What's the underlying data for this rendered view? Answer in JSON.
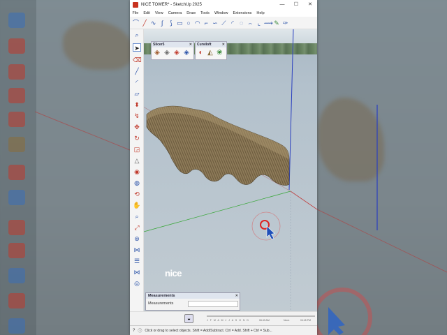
{
  "window": {
    "title": "NICE TOWER* - SketchUp 2025",
    "minimize": "—",
    "maximize": "☐",
    "close": "✕"
  },
  "menu": [
    "File",
    "Edit",
    "View",
    "Camera",
    "Draw",
    "Tools",
    "Window",
    "Extensions",
    "Help"
  ],
  "panels": {
    "slicer": {
      "title": "Slicer5",
      "close": "✕"
    },
    "curviloft": {
      "title": "Curviloft",
      "close": "✕"
    }
  },
  "measurements": {
    "title": "Measurements",
    "close": "✕",
    "label": "Measurements",
    "value": ""
  },
  "shadows": {
    "months": "J F M A M J J A S O N D",
    "time_start": "06:43 AM",
    "time_noon": "Noon",
    "time_end": "04:45 PM"
  },
  "status": {
    "text": "Click or drag to select objects. Shift = Add/Subtract. Ctrl = Add. Shift + Ctrl = Sub..."
  },
  "watermark": "nice"
}
